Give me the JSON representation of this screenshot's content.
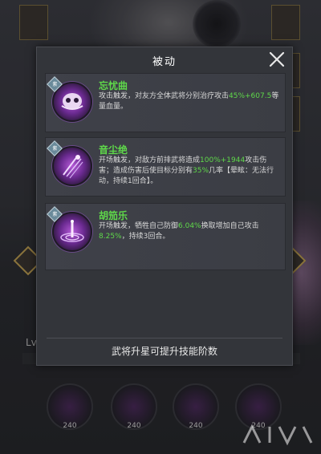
{
  "modal": {
    "title": "被动",
    "footer_text": "武将升星可提升技能阶数"
  },
  "skills": [
    {
      "name": "忘忧曲",
      "badge": "紫",
      "desc_parts": [
        "攻击触发，对友方全体武将分别治疗攻击",
        "45%+607.5",
        "等量血量。"
      ]
    },
    {
      "name": "音尘绝",
      "badge": "紫",
      "desc_parts": [
        "开场触发，对敌方前排武将造成",
        "100%+1944",
        "攻击伤害；造成伤害后使目标分别有",
        "35%",
        "几率【晕眩：无法行动，持续1回合】。"
      ]
    },
    {
      "name": "胡笳乐",
      "badge": "紫",
      "desc_parts": [
        "开场触发，牺牲自己防御",
        "6.04%",
        "换取增加自己攻击",
        "8.25%",
        "，持续3回合。"
      ]
    }
  ],
  "background": {
    "level_label": "Lv",
    "skill_levels": [
      "240",
      "240",
      "240",
      "240"
    ]
  },
  "colors": {
    "highlight": "#5fd84a",
    "panel": "#33353a",
    "skill_icon": "#8a3ab8"
  }
}
